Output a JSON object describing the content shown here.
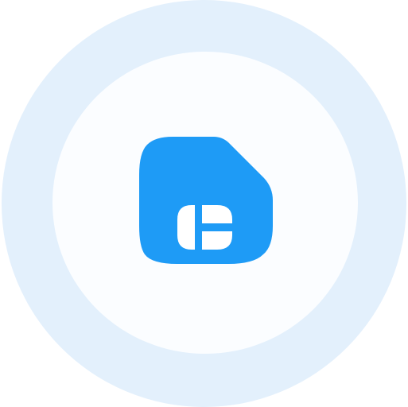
{
  "colors": {
    "ring_outer": "#e3f0fc",
    "ring_inner": "#fbfdff",
    "icon_fill": "#1e9bf6",
    "icon_glyph": "#ffffff"
  },
  "icon": {
    "name": "sim-card-icon"
  }
}
